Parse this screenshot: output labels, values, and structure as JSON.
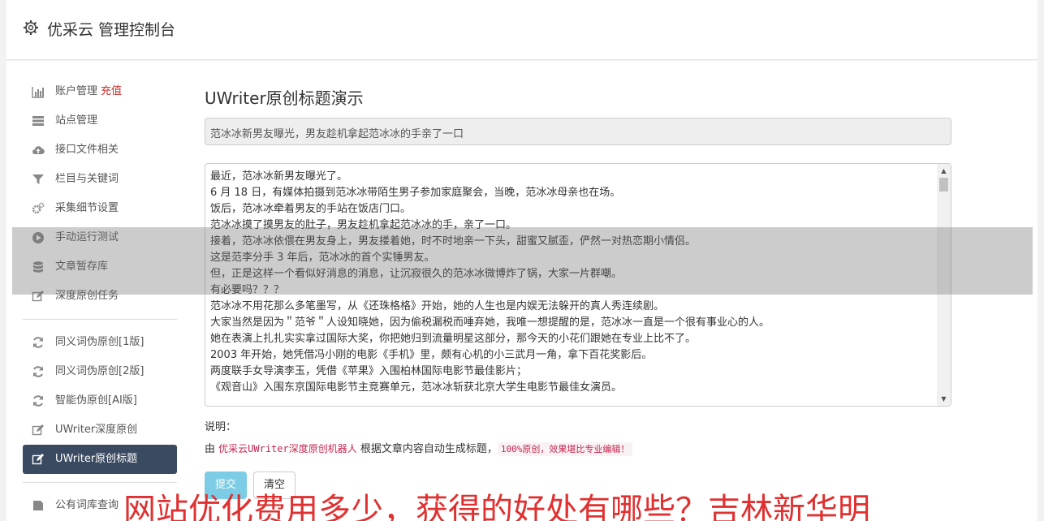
{
  "header": {
    "title": "优采云 管理控制台",
    "icon": "gear-icon"
  },
  "sidebar": {
    "account": {
      "label": "账户管理",
      "badge": "充值",
      "icon": "bar-chart-icon"
    },
    "group1": [
      {
        "label": "站点管理",
        "icon": "server-icon"
      },
      {
        "label": "接口文件相关",
        "icon": "cloud-upload-icon"
      },
      {
        "label": "栏目与关键词",
        "icon": "filter-icon"
      },
      {
        "label": "采集细节设置",
        "icon": "cogs-icon"
      },
      {
        "label": "手动运行测试",
        "icon": "play-circle-icon"
      },
      {
        "label": "文章暂存库",
        "icon": "database-icon"
      },
      {
        "label": "深度原创任务",
        "icon": "edit-icon"
      }
    ],
    "group2": [
      {
        "label": "同义词伪原创[1版]",
        "icon": "refresh-icon"
      },
      {
        "label": "同义词伪原创[2版]",
        "icon": "refresh-icon"
      },
      {
        "label": "智能伪原创[AI版]",
        "icon": "refresh-icon"
      },
      {
        "label": "UWriter深度原创",
        "icon": "edit-icon"
      },
      {
        "label": "UWriter原创标题",
        "icon": "edit-icon",
        "active": true
      }
    ],
    "group3": [
      {
        "label": "公有词库查询",
        "icon": "book-icon"
      }
    ]
  },
  "main": {
    "heading": "UWriter原创标题演示",
    "title_value": "范冰冰新男友曝光，男友趁机拿起范冰冰的手亲了一口",
    "content_lines": [
      "最近，范冰冰新男友曝光了。",
      "6 月 18 日，有媒体拍摄到范冰冰带陌生男子参加家庭聚会，当晚，范冰冰母亲也在场。",
      "饭后，范冰冰牵着男友的手站在饭店门口。",
      "范冰冰摸了摸男友的肚子，男友趁机拿起范冰冰的手，亲了一口。",
      "接着，范冰冰依偎在男友身上，男友搂着她，时不时地亲一下头，甜蜜又腻歪，俨然一对热恋期小情侣。",
      "这是范李分手 3 年后，范冰冰的首个实锤男友。",
      "但，正是这样一个看似好消息的消息，让沉寂很久的范冰冰微博炸了锅，大家一片群嘲。",
      "有必要吗？？？",
      "范冰冰不用花那么多笔墨写，从《还珠格格》开始，她的人生也是内娱无法躲开的真人秀连续剧。",
      "大家当然是因为＂范爷＂人设知晓她，因为偷税漏税而唾弃她，我唯一想提醒的是，范冰冰一直是一个很有事业心的人。",
      "她在表演上扎扎实实拿过国际大奖，你把她归到流量明星这部分，那今天的小花们跟她在专业上比不了。",
      "2003 年开始，她凭借冯小刚的电影《手机》里，颇有心机的小三武月一角，拿下百花奖影后。",
      "两度联手女导演李玉，凭借《苹果》入围柏林国际电影节最佳影片；",
      "《观音山》入围东京国际电影节主竞赛单元，范冰冰斩获北京大学生电影节最佳女演员。"
    ],
    "note_label": "说明：",
    "note_prefix": "由",
    "note_code1": "优采云UWriter深度原创机器人",
    "note_mid": "根据文章内容自动生成标题，",
    "note_code2": "100%原创，效果堪比专业编辑！",
    "submit_label": "提交",
    "clear_label": "清空"
  },
  "watermark": "网站优化费用多少，获得的好处有哪些？吉林新华明"
}
